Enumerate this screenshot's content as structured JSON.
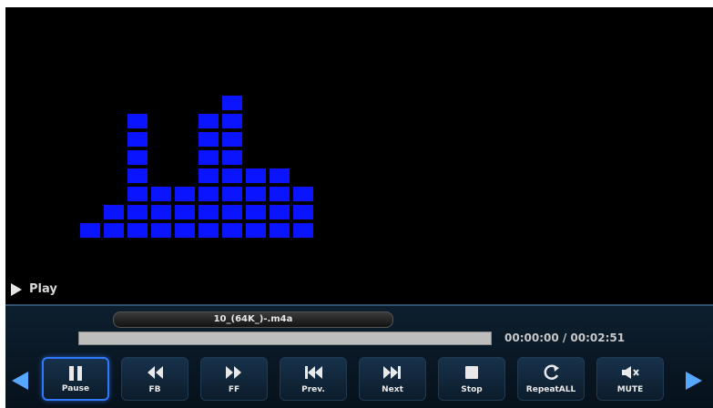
{
  "status": {
    "mode_label": "Play"
  },
  "player": {
    "filename": "10_(64K_)-.m4a",
    "progress": 0.0,
    "time_current": "00:00:00",
    "time_total": "00:02:51",
    "time_display": "00:00:00 / 00:02:51"
  },
  "visualizer": {
    "color": "#0a14ff",
    "levels": [
      1,
      2,
      7,
      3,
      3,
      7,
      8,
      4,
      4,
      3
    ]
  },
  "controls": [
    {
      "name": "pause-button",
      "label": "Pause",
      "icon": "pause-icon",
      "active": true
    },
    {
      "name": "fast-backward-button",
      "label": "FB",
      "icon": "fast-backward-icon",
      "active": false
    },
    {
      "name": "fast-forward-button",
      "label": "FF",
      "icon": "fast-forward-icon",
      "active": false
    },
    {
      "name": "previous-button",
      "label": "Prev.",
      "icon": "skip-previous-icon",
      "active": false
    },
    {
      "name": "next-button",
      "label": "Next",
      "icon": "skip-next-icon",
      "active": false
    },
    {
      "name": "stop-button",
      "label": "Stop",
      "icon": "stop-icon",
      "active": false
    },
    {
      "name": "repeat-button",
      "label": "RepeatALL",
      "icon": "repeat-icon",
      "active": false
    },
    {
      "name": "mute-button",
      "label": "MUTE",
      "icon": "mute-icon",
      "active": false
    }
  ],
  "colors": {
    "screen_bg": "#000000",
    "panel_bg": "#0d1f2f",
    "active_outline": "#2f79ff",
    "nav_arrow": "#55a7ff"
  }
}
